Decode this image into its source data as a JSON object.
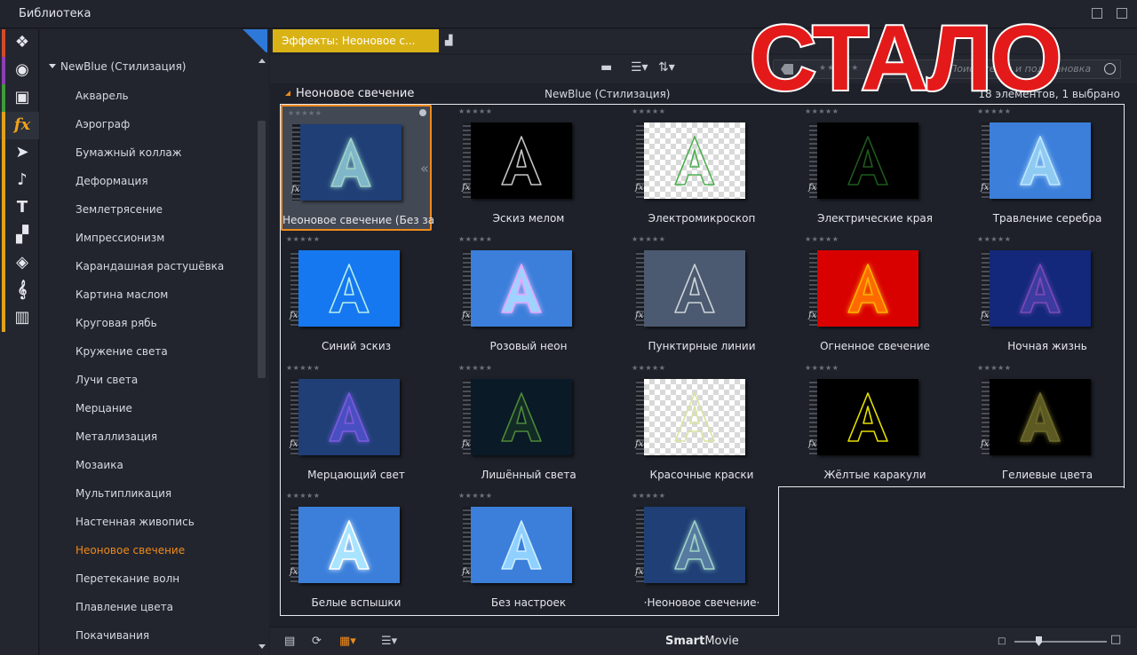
{
  "window": {
    "title": "Библиотека"
  },
  "rail": [
    {
      "name": "projects-icon",
      "glyph": "❖",
      "color": "#d24a2a"
    },
    {
      "name": "video-reel-icon",
      "glyph": "◉",
      "color": "#8b3fb3"
    },
    {
      "name": "photos-icon",
      "glyph": "▣",
      "color": "#3f9a3a"
    },
    {
      "name": "effects-icon",
      "glyph": "fx",
      "color": "#e0a21c"
    },
    {
      "name": "transitions-icon",
      "glyph": "➤",
      "color": "#e0a21c"
    },
    {
      "name": "music-icon",
      "glyph": "♪",
      "color": "#e0a21c"
    },
    {
      "name": "titles-icon",
      "glyph": "T",
      "color": "#e0a21c"
    },
    {
      "name": "montage-icon",
      "glyph": "▞",
      "color": "#e0a21c"
    },
    {
      "name": "layers-icon",
      "glyph": "◈",
      "color": "#e0a21c"
    },
    {
      "name": "scorefitter-icon",
      "glyph": "𝄞",
      "color": "#e0a21c"
    },
    {
      "name": "piano-icon",
      "glyph": "▥",
      "color": "#e0a21c"
    }
  ],
  "tree": {
    "root": "NewBlue (Стилизация)",
    "items": [
      "Акварель",
      "Аэрограф",
      "Бумажный коллаж",
      "Деформация",
      "Землетрясение",
      "Импрессионизм",
      "Карандашная растушёвка",
      "Картина маслом",
      "Круговая рябь",
      "Кружение света",
      "Лучи света",
      "Мерцание",
      "Металлизация",
      "Мозаика",
      "Мультипликация",
      "Настенная живопись",
      "Неоновое свечение",
      "Перетекание волн",
      "Плавление цвета",
      "Покачивания"
    ],
    "selected_index": 16
  },
  "tab": {
    "label": "Эффекты: Неоновое с..."
  },
  "search": {
    "placeholder": "Поиск тегов и подстановка"
  },
  "section": {
    "name": "Неоновое свечение",
    "category": "NewBlue (Стилизация)",
    "count": "18 элементов, 1 выбрано"
  },
  "items": [
    {
      "label": "Неоновое свечение (Без за...",
      "bg": "#1f3f76",
      "letter_fill": "#7fb6c9",
      "stroke": "#9fd3c8",
      "glow": "#a8e0c0",
      "checker": false,
      "selected": true
    },
    {
      "label": "Эскиз мелом",
      "bg": "#000000",
      "letter_fill": "none",
      "stroke": "#c7c7c7",
      "glow": "none",
      "checker": false
    },
    {
      "label": "Электромикроскоп",
      "bg": "#ffffff",
      "letter_fill": "none",
      "stroke": "#4caf50",
      "glow": "none",
      "checker": true
    },
    {
      "label": "Электрические края",
      "bg": "#000000",
      "letter_fill": "none",
      "stroke": "#1e5a1e",
      "glow": "none",
      "checker": false
    },
    {
      "label": "Травление серебра",
      "bg": "#3b7fdb",
      "letter_fill": "#8fcaf2",
      "stroke": "#bfe6ff",
      "glow": "#9bd0ff",
      "checker": false
    },
    {
      "label": "Синий эскиз",
      "bg": "#1678f0",
      "letter_fill": "none",
      "stroke": "#b9f0ee",
      "glow": "none",
      "checker": false
    },
    {
      "label": "Розовый неон",
      "bg": "#3b7fdb",
      "letter_fill": "#9fd3ff",
      "stroke": "#e7a8ff",
      "glow": "#e0a0ff",
      "checker": false
    },
    {
      "label": "Пунктирные линии",
      "bg": "#4b5a70",
      "letter_fill": "none",
      "stroke": "#cfd4da",
      "glow": "none",
      "checker": false
    },
    {
      "label": "Огненное свечение",
      "bg": "#d90000",
      "letter_fill": "#ff6a00",
      "stroke": "#ffb300",
      "glow": "#ff5500",
      "checker": false
    },
    {
      "label": "Ночная жизнь",
      "bg": "#13287a",
      "letter_fill": "#3b3aa0",
      "stroke": "#7b4bb8",
      "glow": "#6a3ab0",
      "checker": false
    },
    {
      "label": "Мерцающий свет",
      "bg": "#1f3f76",
      "letter_fill": "#4a4fc0",
      "stroke": "#7c5ae0",
      "glow": "#8a4cf0",
      "checker": false
    },
    {
      "label": "Лишённый света",
      "bg": "#0a1a26",
      "letter_fill": "#132b25",
      "stroke": "#4d8a3a",
      "glow": "none",
      "checker": false
    },
    {
      "label": "Красочные краски",
      "bg": "#ffffff",
      "letter_fill": "none",
      "stroke": "#d7e3a0",
      "glow": "none",
      "checker": true
    },
    {
      "label": "Жёлтые каракули",
      "bg": "#000000",
      "letter_fill": "none",
      "stroke": "#e6e000",
      "glow": "none",
      "checker": false
    },
    {
      "label": "Гелиевые цвета",
      "bg": "#000000",
      "letter_fill": "#5c5a20",
      "stroke": "#6e6a2a",
      "glow": "#7a7530",
      "checker": false
    },
    {
      "label": "Белые вспышки",
      "bg": "#3b7fdb",
      "letter_fill": "#a8e4ff",
      "stroke": "#ffffff",
      "glow": "#ffffff",
      "checker": false
    },
    {
      "label": "Без настроек",
      "bg": "#3b7fdb",
      "letter_fill": "#8fd0ff",
      "stroke": "#cdeeff",
      "glow": "none",
      "checker": false
    },
    {
      "label": "·Неоновое свечение·",
      "bg": "#1f3f76",
      "letter_fill": "#567aa0",
      "stroke": "#9fd3c8",
      "glow": "#8fd0b8",
      "checker": false
    }
  ],
  "bottom": {
    "brand_bold": "Smart",
    "brand_rest": "Movie"
  },
  "overlay": {
    "text": "СТАЛО"
  }
}
